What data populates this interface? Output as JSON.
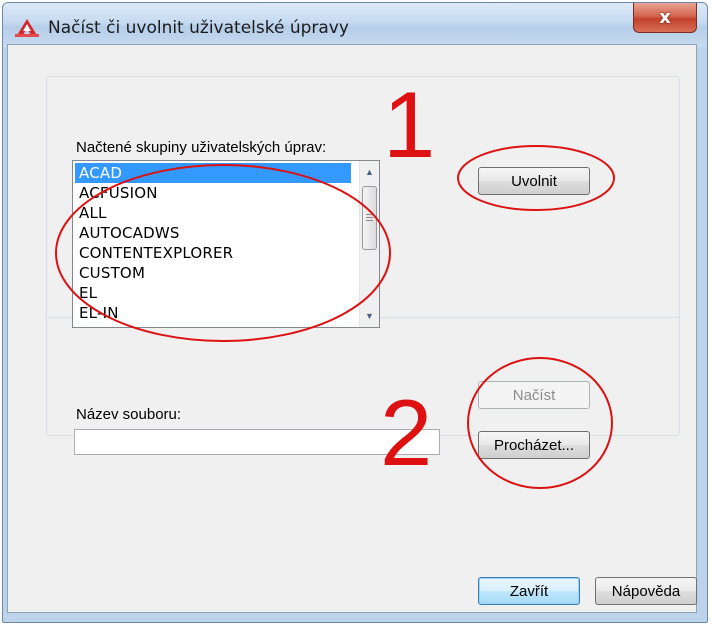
{
  "window": {
    "title": "Načíst či uvolnit uživatelské úpravy",
    "close_glyph": "x",
    "app_icon": "autocad-icon"
  },
  "loaded_groups": {
    "label": "Načtené skupiny uživatelských úprav:",
    "items": [
      "ACAD",
      "ACFUSION",
      "ALL",
      "AUTOCADWS",
      "CONTENTEXPLORER",
      "CUSTOM",
      "EL",
      "EL-IN"
    ],
    "selected": "ACAD",
    "unload_button": "Uvolnit"
  },
  "file": {
    "label": "Název souboru:",
    "value": "",
    "load_button": "Načíst",
    "browse_button": "Procházet..."
  },
  "footer": {
    "close_button": "Zavřít",
    "help_button": "Nápověda"
  },
  "annotations": {
    "marker_1": "1",
    "marker_2": "2",
    "color": "#dd1111"
  },
  "colors": {
    "selection": "#3399ff",
    "dialog_bg": "#f0f0f0",
    "title_bg": "#c5daf0"
  }
}
